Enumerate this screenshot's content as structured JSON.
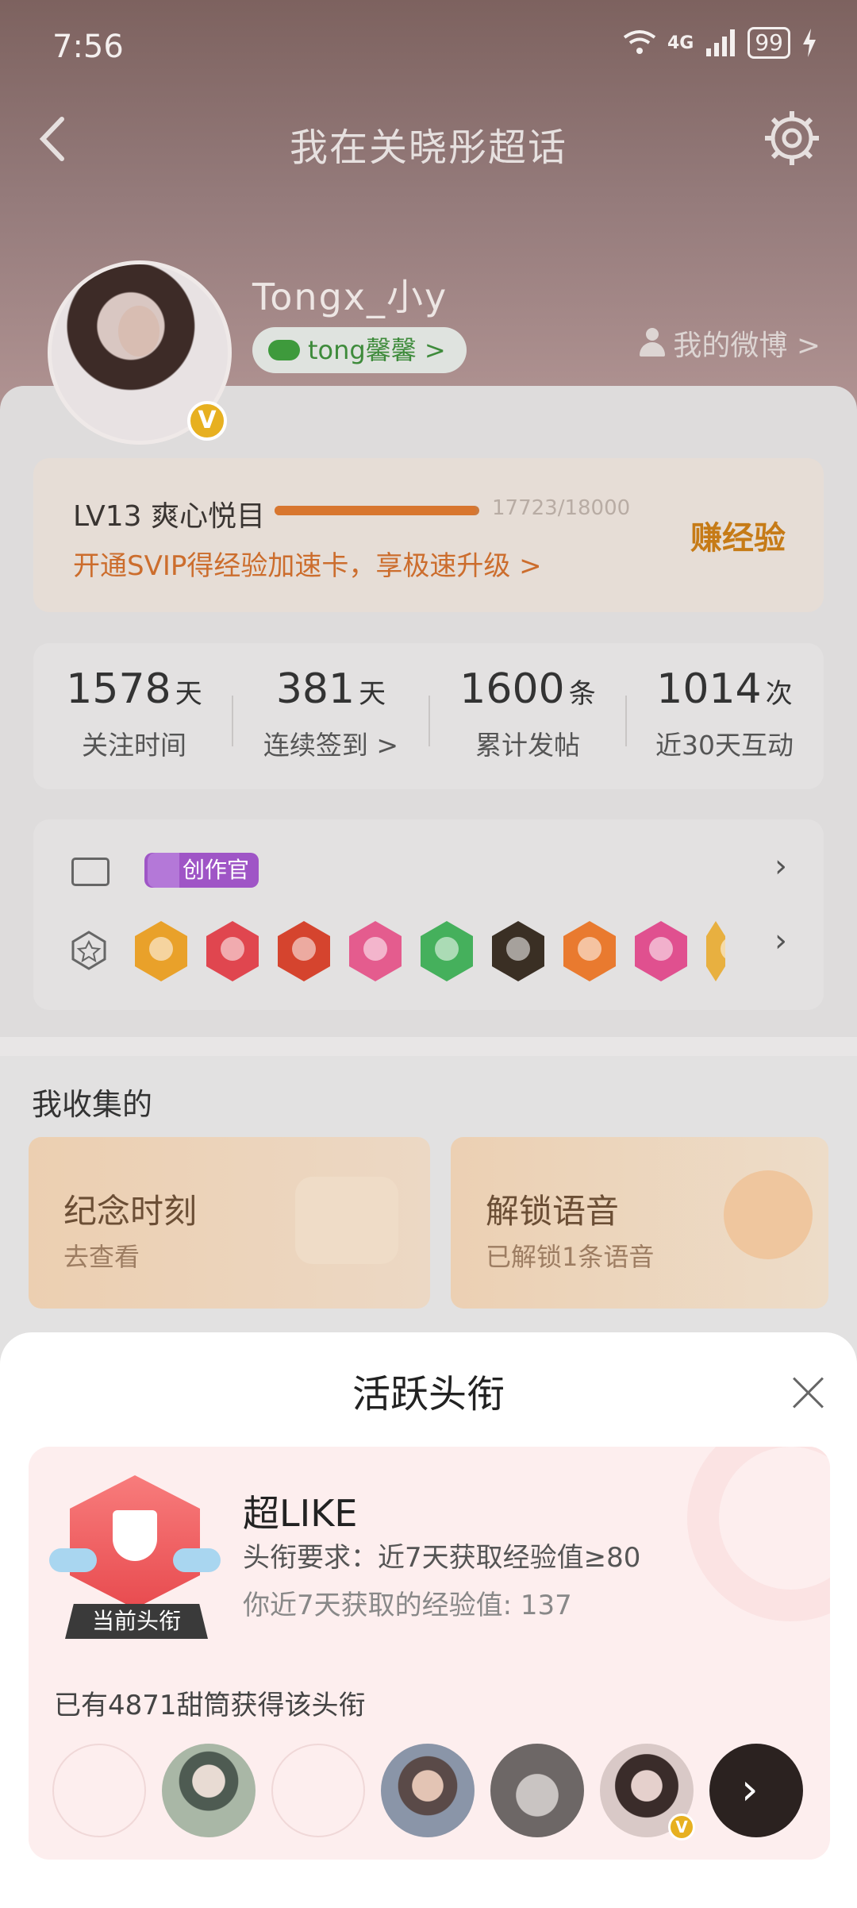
{
  "status": {
    "time": "7:56",
    "network": "4G",
    "battery": "99"
  },
  "header": {
    "title": "我在关晓彤超话"
  },
  "profile": {
    "username": "Tongx_小y",
    "fan_group": "tong馨馨 >",
    "my_weibo": "我的微博 >",
    "verified": "V"
  },
  "level": {
    "name": "LV13 爽心悦目",
    "exp": "17723/18000",
    "progress": 0.985,
    "svip_tip": "开通SVIP得经验加速卡，享极速升级 >",
    "earn": "赚经验"
  },
  "stats": [
    {
      "num": "1578",
      "unit": "天",
      "label": "关注时间"
    },
    {
      "num": "381",
      "unit": "天",
      "label": "连续签到 >"
    },
    {
      "num": "1600",
      "unit": "条",
      "label": "累计发帖"
    },
    {
      "num": "1014",
      "unit": "次",
      "label": "近30天互动"
    }
  ],
  "badges": {
    "creator_label": "创作官",
    "medal_colors": [
      "#e9a12a",
      "#e0464f",
      "#d5442e",
      "#e45c8e",
      "#45b05c",
      "#3a2f24",
      "#e97a2f",
      "#e0508f",
      "#e8b040"
    ]
  },
  "collected": {
    "title": "我收集的",
    "cards": [
      {
        "title": "纪念时刻",
        "sub": "去查看"
      },
      {
        "title": "解锁语音",
        "sub": "已解锁1条语音"
      }
    ]
  },
  "modal": {
    "title": "活跃头衔",
    "badge_name": "超LIKE",
    "requirement": "头衔要求：近7天获取经验值≥80",
    "my_exp": "你近7天获取的经验值: 137",
    "current_label": "当前头衔",
    "owners_text": "已有4871甜筒获得该头衔",
    "more_icon": "chevron-right-icon"
  }
}
